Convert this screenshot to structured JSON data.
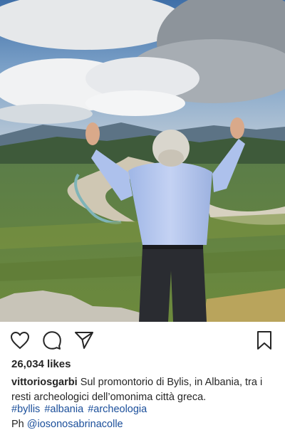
{
  "colors": {
    "link": "#1a4e9a",
    "text": "#262626"
  },
  "photo": {
    "description_icon": "landscape-photo",
    "alt": ""
  },
  "actions": {
    "like_icon": "heart-icon",
    "comment_icon": "comment-icon",
    "share_icon": "share-icon",
    "save_icon": "bookmark-icon"
  },
  "likes": "26,034 likes",
  "caption": {
    "username": "vittoriosgarbi",
    "text": "Sul promontorio di Bylis, in Albania, tra i resti archeologici dell’omonima città greca."
  },
  "hashtags": [
    "#byllis",
    "#albania",
    "#archeologia"
  ],
  "credit": {
    "prefix": "Ph",
    "mention": "@iosonosabrinacolle"
  }
}
